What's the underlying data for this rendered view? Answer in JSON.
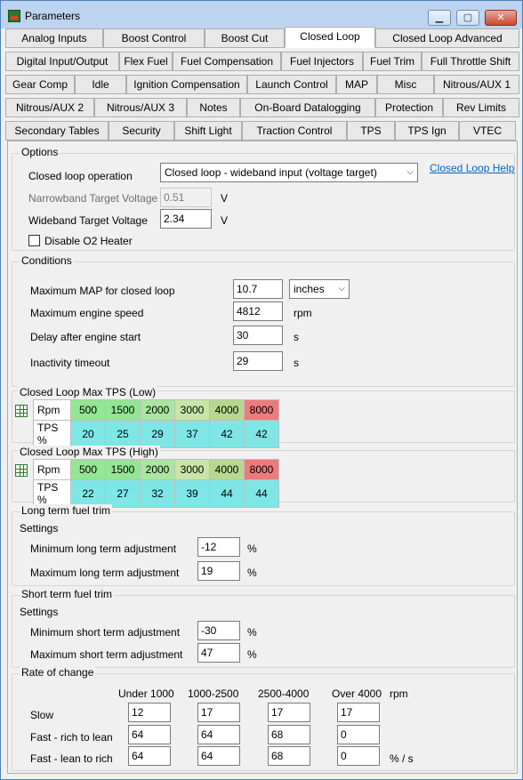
{
  "window": {
    "title": "Parameters"
  },
  "tabs": {
    "row1": [
      "Analog Inputs",
      "Boost Control",
      "Boost Cut",
      "Closed Loop",
      "Closed Loop Advanced"
    ],
    "row2": [
      "Digital Input/Output",
      "Flex Fuel",
      "Fuel Compensation",
      "Fuel Injectors",
      "Fuel Trim",
      "Full Throttle Shift"
    ],
    "row3": [
      "Gear Comp",
      "Idle",
      "Ignition Compensation",
      "Launch Control",
      "MAP",
      "Misc",
      "Nitrous/AUX 1"
    ],
    "row4": [
      "Nitrous/AUX 2",
      "Nitrous/AUX 3",
      "Notes",
      "On-Board Datalogging",
      "Protection",
      "Rev Limits"
    ],
    "row5": [
      "Secondary Tables",
      "Security",
      "Shift Light",
      "Traction Control",
      "TPS",
      "TPS Ign",
      "VTEC"
    ],
    "active": "Closed Loop"
  },
  "options": {
    "title": "Options",
    "closed_loop_operation_label": "Closed loop operation",
    "closed_loop_operation_value": "Closed loop - wideband input (voltage target)",
    "help_link": "Closed Loop Help",
    "narrowband_label": "Narrowband Target Voltage",
    "narrowband_value": "0.51",
    "narrowband_unit": "V",
    "wideband_label": "Wideband Target Voltage",
    "wideband_value": "2.34",
    "wideband_unit": "V",
    "disable_o2_label": "Disable O2 Heater"
  },
  "conditions": {
    "title": "Conditions",
    "max_map_label": "Maximum MAP for closed loop",
    "max_map_value": "10.7",
    "max_map_unit": "inches",
    "max_rpm_label": "Maximum engine speed",
    "max_rpm_value": "4812",
    "max_rpm_unit": "rpm",
    "delay_label": "Delay after engine start",
    "delay_value": "30",
    "delay_unit": "s",
    "inactivity_label": "Inactivity timeout",
    "inactivity_value": "29",
    "inactivity_unit": "s"
  },
  "tps_low": {
    "title": "Closed Loop Max TPS (Low)",
    "row1_label": "Rpm",
    "row2_label": "TPS %",
    "rpm": [
      "500",
      "1500",
      "2000",
      "3000",
      "4000",
      "8000"
    ],
    "tps": [
      "20",
      "25",
      "29",
      "37",
      "42",
      "42"
    ]
  },
  "tps_high": {
    "title": "Closed Loop Max TPS (High)",
    "row1_label": "Rpm",
    "row2_label": "TPS %",
    "rpm": [
      "500",
      "1500",
      "2000",
      "3000",
      "4000",
      "8000"
    ],
    "tps": [
      "22",
      "27",
      "32",
      "39",
      "44",
      "44"
    ]
  },
  "rpm_colors": [
    "#93e693",
    "#93e693",
    "#a9e69f",
    "#c8e6a8",
    "#b7d88f",
    "#ee7b7b"
  ],
  "tps_color": "#7fe6e6",
  "long_term": {
    "title": "Long term fuel trim",
    "settings": "Settings",
    "min_label": "Minimum long term adjustment",
    "min_value": "-12",
    "max_label": "Maximum long term adjustment",
    "max_value": "19",
    "unit": "%"
  },
  "short_term": {
    "title": "Short term fuel trim",
    "settings": "Settings",
    "min_label": "Minimum short term adjustment",
    "min_value": "-30",
    "max_label": "Maximum short term adjustment",
    "max_value": "47",
    "unit": "%"
  },
  "rate": {
    "title": "Rate of change",
    "headers": [
      "Under 1000",
      "1000-2500",
      "2500-4000",
      "Over 4000",
      "rpm"
    ],
    "rows": [
      {
        "label": "Slow",
        "values": [
          "12",
          "17",
          "17",
          "17"
        ]
      },
      {
        "label": "Fast - rich to lean",
        "values": [
          "64",
          "64",
          "68",
          "0"
        ]
      },
      {
        "label": "Fast - lean to rich",
        "values": [
          "64",
          "64",
          "68",
          "0"
        ]
      }
    ],
    "unit": "% / s"
  }
}
